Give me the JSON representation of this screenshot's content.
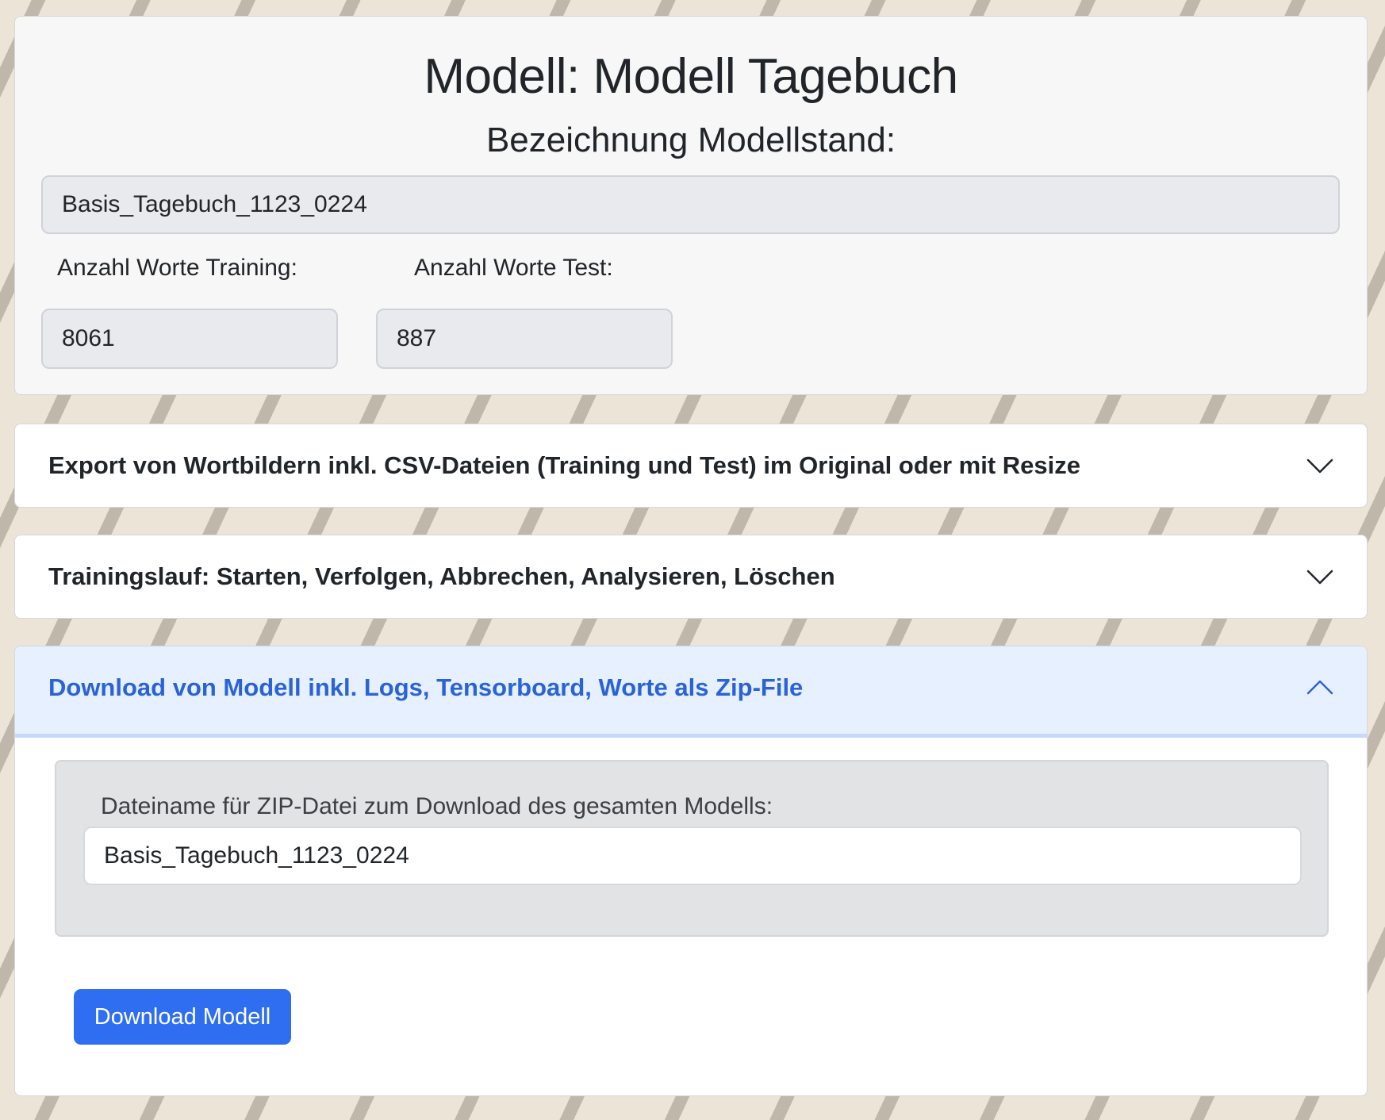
{
  "header": {
    "title": "Modell: Modell Tagebuch",
    "subtitle": "Bezeichnung Modellstand:",
    "model_state_value": "Basis_Tagebuch_1123_0224",
    "training_label": "Anzahl Worte Training:",
    "training_value": "8061",
    "test_label": "Anzahl Worte Test:",
    "test_value": "887"
  },
  "accordion": {
    "items": [
      {
        "title": "Export von Wortbildern inkl. CSV-Dateien (Training und Test) im Original oder mit Resize",
        "expanded": false,
        "icon": "chevron-down-icon"
      },
      {
        "title": "Trainingslauf: Starten, Verfolgen, Abbrechen, Analysieren, Löschen",
        "expanded": false,
        "icon": "chevron-down-icon"
      },
      {
        "title": "Download von Modell inkl. Logs, Tensorboard, Worte als Zip-File",
        "expanded": true,
        "icon": "chevron-up-icon"
      }
    ]
  },
  "download": {
    "zip_label": "Dateiname für ZIP-Datei zum Download des gesamten Modells:",
    "zip_value": "Basis_Tagebuch_1123_0224",
    "button_label": "Download Modell"
  },
  "colors": {
    "accent": "#2f6ef0",
    "active_header_bg": "#e7f0fe",
    "active_header_text": "#2a63d8"
  }
}
